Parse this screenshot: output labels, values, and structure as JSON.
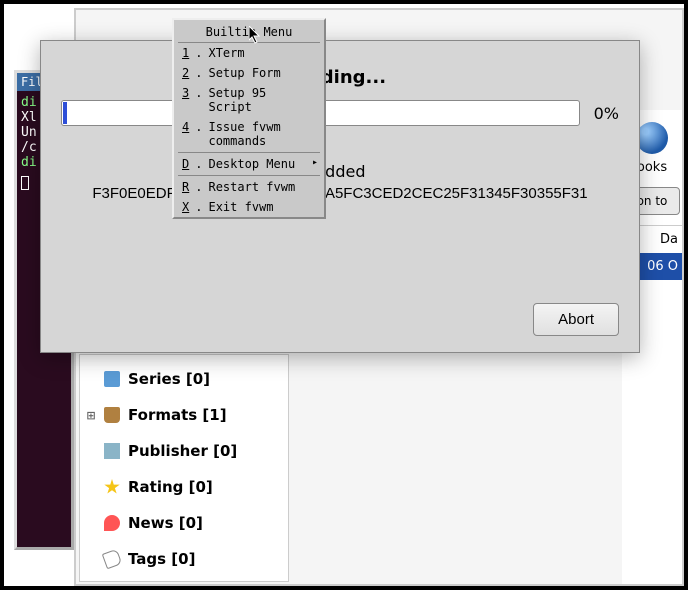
{
  "terminal": {
    "title": "Fil",
    "lines": [
      "di",
      "Xl",
      "Un",
      "/c",
      "di"
    ]
  },
  "rightPanel": {
    "label": "ooks",
    "buttonFragment": "on to",
    "headerFragment": "Da",
    "cellFragment": "06 O"
  },
  "sidebar": {
    "items": [
      {
        "icon": "series",
        "label": "Series [0]",
        "expandable": false
      },
      {
        "icon": "formats",
        "label": "Formats [1]",
        "expandable": true
      },
      {
        "icon": "publisher",
        "label": "Publisher [0]",
        "expandable": false
      },
      {
        "icon": "rating",
        "label": "Rating [0]",
        "expandable": false
      },
      {
        "icon": "news",
        "label": "News [0]",
        "expandable": false
      },
      {
        "icon": "tags",
        "label": "Tags [0]",
        "expandable": false
      }
    ]
  },
  "dialog": {
    "title": "Adding...",
    "percent": "0%",
    "statusLabel": "Added",
    "hash": "F3F0E0EDF25FF4E8E75FCCD1CA5FC3CED2CEC25F31345F30355F31",
    "abortLabel": "Abort"
  },
  "fvwmMenu": {
    "title": "Builtin Menu",
    "items": [
      {
        "mnemonic": "1",
        "label": "XTerm",
        "submenu": false
      },
      {
        "mnemonic": "2",
        "label": "Setup Form",
        "submenu": false
      },
      {
        "mnemonic": "3",
        "label": "Setup 95 Script",
        "submenu": false
      },
      {
        "mnemonic": "4",
        "label": "Issue fvwm commands",
        "submenu": false
      },
      {
        "mnemonic": "D",
        "label": "Desktop Menu",
        "submenu": true
      },
      {
        "mnemonic": "R",
        "label": "Restart fvwm",
        "submenu": false
      },
      {
        "mnemonic": "X",
        "label": "Exit fvwm",
        "submenu": false
      }
    ]
  }
}
